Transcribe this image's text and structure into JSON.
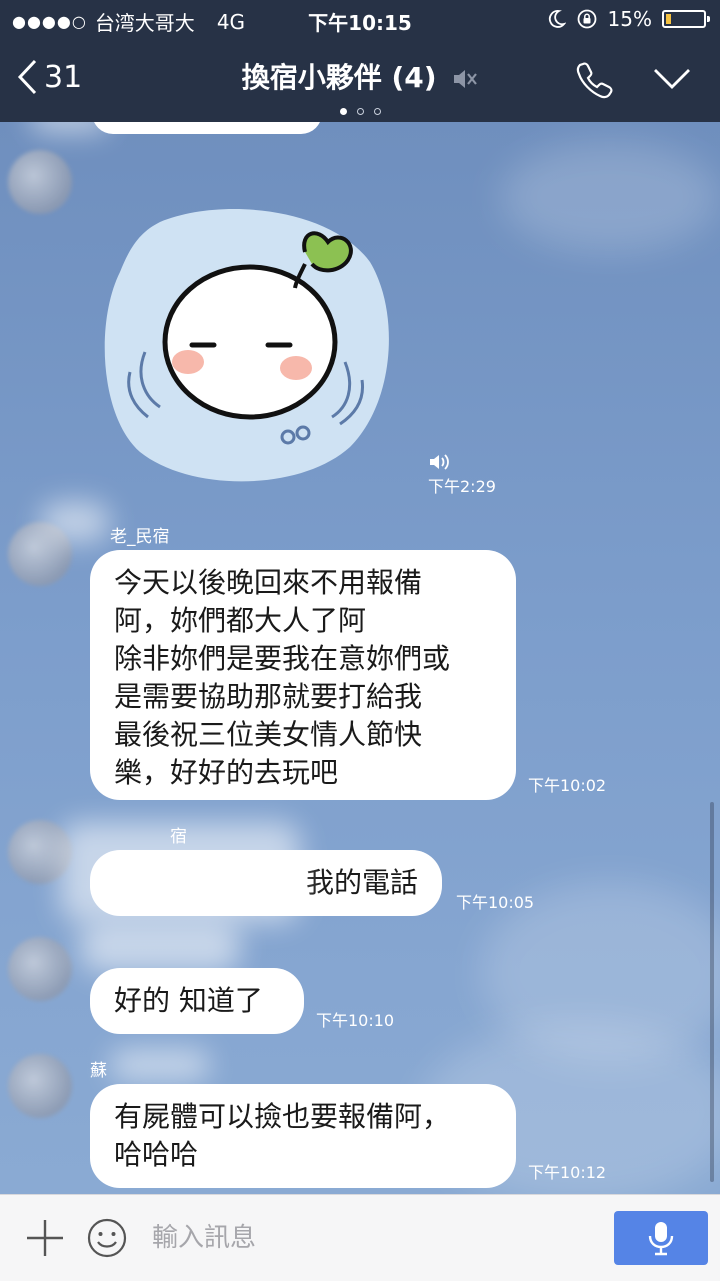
{
  "status_bar": {
    "carrier": "台湾大哥大",
    "network": "4G",
    "time": "下午10:15",
    "battery": "15%",
    "battery_level": 0.15,
    "signal_dots": "●●●●○"
  },
  "nav": {
    "back_count": "31",
    "title": "換宿小夥伴 (4)",
    "page_indicator_active": 0,
    "page_indicator_count": 3
  },
  "messages": [
    {
      "type": "sticker",
      "time": "下午2:29"
    },
    {
      "type": "text",
      "sender": "老_民宿",
      "lines": [
        "今天以後晚回來不用報備",
        "阿，妳們都大人了阿",
        "除非妳們是要我在意妳們或",
        "是需要協助那就要打給我",
        "最後祝三位美女情人節快",
        "樂，好好的去玩吧"
      ],
      "time": "下午10:02"
    },
    {
      "type": "text",
      "sender": "宿",
      "lines": [
        "我的電話"
      ],
      "time": "下午10:05"
    },
    {
      "type": "text",
      "sender": "",
      "lines": [
        "好的 知道了"
      ],
      "time": "下午10:10"
    },
    {
      "type": "text",
      "sender": "蘇",
      "lines": [
        "有屍體可以撿也要報備阿，",
        "哈哈哈"
      ],
      "time": "下午10:12"
    }
  ],
  "input": {
    "placeholder": "輸入訊息",
    "value": ""
  },
  "colors": {
    "header_bg": "#273246",
    "chat_bg": "#7a9cc8",
    "send_button": "#5584e6",
    "battery_fill": "#f5c242"
  },
  "icons": {
    "back": "chevron-left-icon",
    "mute": "speaker-mute-icon",
    "call": "phone-icon",
    "menu": "chevron-down-icon",
    "add": "plus-icon",
    "emoji": "smiley-icon",
    "voice": "microphone-icon",
    "sticker_sound": "speaker-icon"
  }
}
